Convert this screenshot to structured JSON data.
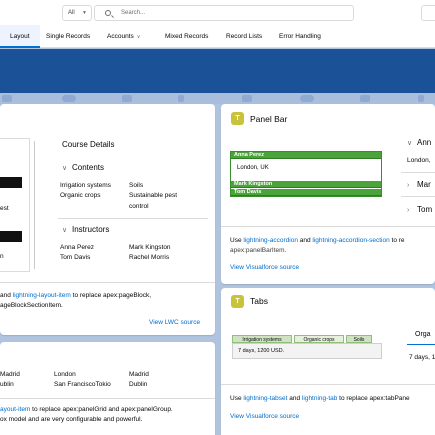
{
  "header": {
    "scope": "All",
    "search_placeholder": "Search..."
  },
  "nav": {
    "items": [
      "Layout",
      "Single Records",
      "Accounts",
      "Mixed Records",
      "Record Lists",
      "Error Handling"
    ]
  },
  "left_top_card": {
    "side_frag": [
      "est",
      "n"
    ],
    "course_details_title": "Course Details",
    "contents_header": "Contents",
    "contents": [
      "Irrigation systems",
      "Soils",
      "Organic crops",
      "Sustainable pest",
      "control"
    ],
    "instructors_header": "Instructors",
    "instructors": [
      "Anna Perez",
      "Mark Kingston",
      "Tom Davis",
      "Rachel Morris"
    ],
    "footer_line1_pre": "and ",
    "footer_line1_link": "lightning-layout-item",
    "footer_line1_post": " to replace apex:pageBlock,",
    "footer_line2": "ageBlockSectionItem.",
    "view_link": "View LWC source"
  },
  "left_bottom_card": {
    "row1": [
      "Madrid",
      "London",
      "Madrid"
    ],
    "row2": [
      "ublin",
      "San FranciscoTokio",
      "Dublin"
    ],
    "footer_line1_link": "ayout-item",
    "footer_line1_post": " to replace apex:panelGrid and apex:panelGroup.",
    "footer_line2": "ox model and are very configurable and powerful."
  },
  "panel_bar_card": {
    "badge": "T",
    "title": "Panel Bar",
    "items": [
      "Anna Perez",
      "London, UK",
      "Mark Kingston",
      "Tom Davis"
    ],
    "right_accordion": [
      "Ann",
      "London,",
      "Mar",
      "Tom"
    ],
    "use_text_pre": "Use ",
    "use_link1": "lightning-accordion",
    "use_mid": " and ",
    "use_link2": "lightning-accordion-section",
    "use_post": " to re",
    "use_line2": "apex:panelBarItem.",
    "view_link": "View Visualforce source"
  },
  "tabs_card": {
    "badge": "T",
    "title": "Tabs",
    "tabs": [
      "Irrigation systems",
      "Organic crops",
      "Soils"
    ],
    "content": "7 days, 1200 USD.",
    "right_frag_title": "Orga",
    "right_frag_body": "7 days, 1",
    "use_text_pre": "Use ",
    "use_link1": "lightning-tabset",
    "use_mid": " and ",
    "use_link2": "lightning-tab",
    "use_post": " to replace apex:tabPane",
    "view_link": "View Visualforce source"
  },
  "colors": {
    "brand_blue": "#1b5297",
    "link": "#006dcc",
    "panel_green": "#4aa43a",
    "badge_yellow": "#c9c23b"
  }
}
